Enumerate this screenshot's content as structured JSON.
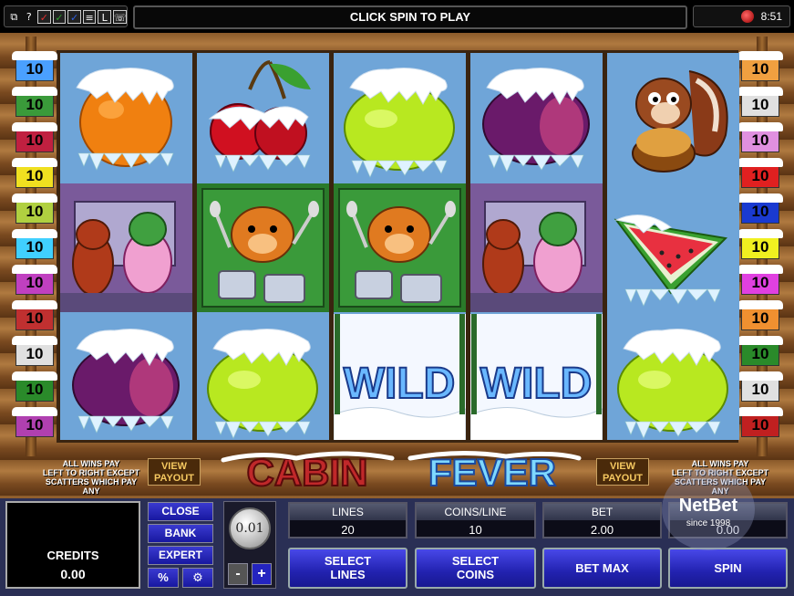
{
  "top_bar": {
    "icons": [
      "window-icon",
      "help-icon",
      "check-icon",
      "check-icon",
      "check-icon",
      "stats-icon",
      "L-icon",
      "phone-icon"
    ],
    "help_glyph": "?",
    "L_glyph": "L",
    "message": "CLICK SPIN TO PLAY",
    "time": "8:51"
  },
  "paylines_left": [
    {
      "label": "10",
      "color": "#4aa0ff"
    },
    {
      "label": "10",
      "color": "#3a9a3a"
    },
    {
      "label": "10",
      "color": "#c02040"
    },
    {
      "label": "10",
      "color": "#f0e020"
    },
    {
      "label": "10",
      "color": "#b0d040"
    },
    {
      "label": "10",
      "color": "#40d0ff"
    },
    {
      "label": "10",
      "color": "#c040c0"
    },
    {
      "label": "10",
      "color": "#c03030"
    },
    {
      "label": "10",
      "color": "#e0e0e0"
    },
    {
      "label": "10",
      "color": "#2a8a2a"
    },
    {
      "label": "10",
      "color": "#b040b0"
    }
  ],
  "paylines_right": [
    {
      "label": "10",
      "color": "#f0a040"
    },
    {
      "label": "10",
      "color": "#e0e0e0"
    },
    {
      "label": "10",
      "color": "#e090e0"
    },
    {
      "label": "10",
      "color": "#e02020"
    },
    {
      "label": "10",
      "color": "#1a3ad0"
    },
    {
      "label": "10",
      "color": "#f0f020"
    },
    {
      "label": "10",
      "color": "#e040e0"
    },
    {
      "label": "10",
      "color": "#f09030"
    },
    {
      "label": "10",
      "color": "#2a8a2a"
    },
    {
      "label": "10",
      "color": "#e0e0e0"
    },
    {
      "label": "10",
      "color": "#c02020"
    }
  ],
  "reels": [
    [
      "orange",
      "bears-dancing",
      "plum"
    ],
    [
      "cherries",
      "bear-drums",
      "lemon"
    ],
    [
      "lemon",
      "bear-drums",
      "wild"
    ],
    [
      "plum",
      "bears-dancing",
      "wild"
    ],
    [
      "squirrel",
      "watermelon",
      "lemon"
    ]
  ],
  "wild_text": "WILD",
  "logo": {
    "word1": "CABIN",
    "word2": "FEVER"
  },
  "all_wins_text": [
    "ALL WINS PAY",
    "LEFT TO RIGHT EXCEPT",
    "SCATTERS WHICH PAY ANY"
  ],
  "view_payout": [
    "VIEW",
    "PAYOUT"
  ],
  "credits": {
    "label": "CREDITS",
    "value": "0.00"
  },
  "side_buttons": {
    "close": "CLOSE",
    "bank": "BANK",
    "expert": "EXPERT",
    "percent": "%"
  },
  "coin": {
    "value": "0.01",
    "minus": "-",
    "plus": "+"
  },
  "fields": [
    {
      "header": "LINES",
      "value": "20"
    },
    {
      "header": "COINS/LINE",
      "value": "10"
    },
    {
      "header": "BET",
      "value": "2.00"
    },
    {
      "header": "",
      "value": "0.00"
    }
  ],
  "buttons": {
    "select_lines": [
      "SELECT",
      "LINES"
    ],
    "select_coins": [
      "SELECT",
      "COINS"
    ],
    "bet_max": "BET MAX",
    "spin": "SPIN"
  },
  "watermark": {
    "brand": "NetBet",
    "since": "since 1998"
  }
}
